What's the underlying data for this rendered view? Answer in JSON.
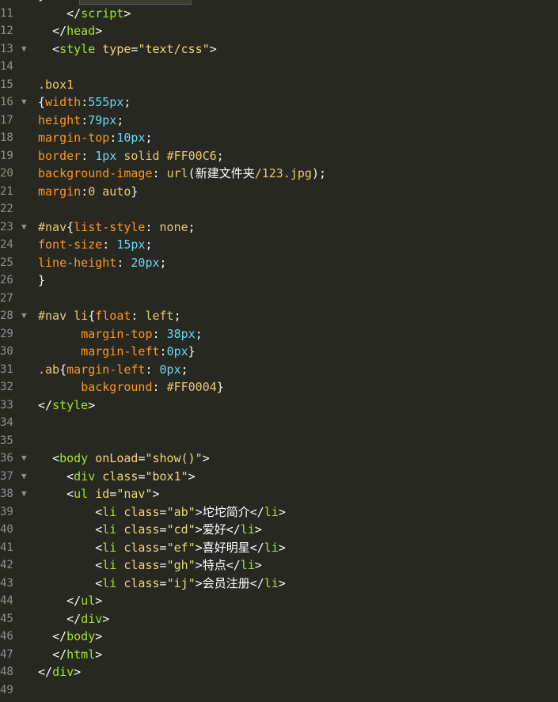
{
  "editor": {
    "theme_background": "#272822",
    "visible_tab_partial": "",
    "lines": [
      {
        "n": "10",
        "fold": false,
        "tokens": [
          {
            "t": "}",
            "c": "t-plain"
          }
        ]
      },
      {
        "n": "11",
        "fold": false,
        "tokens": [
          {
            "t": "    ",
            "c": "t-plain"
          },
          {
            "t": "</",
            "c": "t-punct"
          },
          {
            "t": "script",
            "c": "t-tag"
          },
          {
            "t": ">",
            "c": "t-punct"
          }
        ]
      },
      {
        "n": "12",
        "fold": false,
        "tokens": [
          {
            "t": "  ",
            "c": "t-plain"
          },
          {
            "t": "</",
            "c": "t-punct"
          },
          {
            "t": "head",
            "c": "t-tag"
          },
          {
            "t": ">",
            "c": "t-punct"
          }
        ]
      },
      {
        "n": "13",
        "fold": true,
        "tokens": [
          {
            "t": "  ",
            "c": "t-plain"
          },
          {
            "t": "<",
            "c": "t-punct"
          },
          {
            "t": "style",
            "c": "t-tag"
          },
          {
            "t": " type",
            "c": "t-attr"
          },
          {
            "t": "=",
            "c": "t-punct"
          },
          {
            "t": "\"text/css\"",
            "c": "t-str"
          },
          {
            "t": ">",
            "c": "t-punct"
          }
        ]
      },
      {
        "n": "14",
        "fold": false,
        "tokens": []
      },
      {
        "n": "15",
        "fold": false,
        "tokens": [
          {
            "t": ".box1",
            "c": "t-sel"
          }
        ]
      },
      {
        "n": "16",
        "fold": true,
        "tokens": [
          {
            "t": "{",
            "c": "t-plain"
          },
          {
            "t": "width",
            "c": "t-prop"
          },
          {
            "t": ":",
            "c": "t-plain"
          },
          {
            "t": "555px",
            "c": "t-num"
          },
          {
            "t": ";",
            "c": "t-plain"
          }
        ]
      },
      {
        "n": "17",
        "fold": false,
        "tokens": [
          {
            "t": "height",
            "c": "t-prop"
          },
          {
            "t": ":",
            "c": "t-plain"
          },
          {
            "t": "79px",
            "c": "t-num"
          },
          {
            "t": ";",
            "c": "t-plain"
          }
        ]
      },
      {
        "n": "18",
        "fold": false,
        "tokens": [
          {
            "t": "margin-top",
            "c": "t-prop"
          },
          {
            "t": ":",
            "c": "t-plain"
          },
          {
            "t": "10px",
            "c": "t-num"
          },
          {
            "t": ";",
            "c": "t-plain"
          }
        ]
      },
      {
        "n": "19",
        "fold": false,
        "tokens": [
          {
            "t": "border",
            "c": "t-prop"
          },
          {
            "t": ": ",
            "c": "t-plain"
          },
          {
            "t": "1px",
            "c": "t-num"
          },
          {
            "t": " solid ",
            "c": "t-sel"
          },
          {
            "t": "#FF00C6",
            "c": "t-sel"
          },
          {
            "t": ";",
            "c": "t-plain"
          }
        ]
      },
      {
        "n": "20",
        "fold": false,
        "tokens": [
          {
            "t": "background-image",
            "c": "t-prop"
          },
          {
            "t": ": ",
            "c": "t-plain"
          },
          {
            "t": "url",
            "c": "t-sel"
          },
          {
            "t": "(",
            "c": "t-plain"
          },
          {
            "t": "新建文件夹",
            "c": "t-cjk"
          },
          {
            "t": "/123.jpg",
            "c": "t-sel"
          },
          {
            "t": ");",
            "c": "t-plain"
          }
        ]
      },
      {
        "n": "21",
        "fold": false,
        "tokens": [
          {
            "t": "margin",
            "c": "t-prop"
          },
          {
            "t": ":",
            "c": "t-plain"
          },
          {
            "t": "0 auto",
            "c": "t-sel"
          },
          {
            "t": "}",
            "c": "t-plain"
          }
        ]
      },
      {
        "n": "22",
        "fold": false,
        "tokens": []
      },
      {
        "n": "23",
        "fold": true,
        "tokens": [
          {
            "t": "#nav",
            "c": "t-sel"
          },
          {
            "t": "{",
            "c": "t-plain"
          },
          {
            "t": "list-style",
            "c": "t-prop"
          },
          {
            "t": ": ",
            "c": "t-plain"
          },
          {
            "t": "none",
            "c": "t-sel"
          },
          {
            "t": ";",
            "c": "t-plain"
          }
        ]
      },
      {
        "n": "24",
        "fold": false,
        "tokens": [
          {
            "t": "font-size",
            "c": "t-prop"
          },
          {
            "t": ": ",
            "c": "t-plain"
          },
          {
            "t": "15px",
            "c": "t-num"
          },
          {
            "t": ";",
            "c": "t-plain"
          }
        ]
      },
      {
        "n": "25",
        "fold": false,
        "tokens": [
          {
            "t": "line-height",
            "c": "t-prop"
          },
          {
            "t": ": ",
            "c": "t-plain"
          },
          {
            "t": "20px",
            "c": "t-num"
          },
          {
            "t": ";",
            "c": "t-plain"
          }
        ]
      },
      {
        "n": "26",
        "fold": false,
        "tokens": [
          {
            "t": "}",
            "c": "t-plain"
          }
        ]
      },
      {
        "n": "27",
        "fold": false,
        "tokens": []
      },
      {
        "n": "28",
        "fold": true,
        "tokens": [
          {
            "t": "#nav li",
            "c": "t-sel"
          },
          {
            "t": "{",
            "c": "t-plain"
          },
          {
            "t": "float",
            "c": "t-prop"
          },
          {
            "t": ": ",
            "c": "t-plain"
          },
          {
            "t": "left",
            "c": "t-sel"
          },
          {
            "t": ";",
            "c": "t-plain"
          }
        ]
      },
      {
        "n": "29",
        "fold": false,
        "tokens": [
          {
            "t": "      ",
            "c": "t-plain"
          },
          {
            "t": "margin-top",
            "c": "t-prop"
          },
          {
            "t": ": ",
            "c": "t-plain"
          },
          {
            "t": "38px",
            "c": "t-num"
          },
          {
            "t": ";",
            "c": "t-plain"
          }
        ]
      },
      {
        "n": "30",
        "fold": false,
        "tokens": [
          {
            "t": "      ",
            "c": "t-plain"
          },
          {
            "t": "margin-left",
            "c": "t-prop"
          },
          {
            "t": ":",
            "c": "t-plain"
          },
          {
            "t": "0px",
            "c": "t-num"
          },
          {
            "t": "}",
            "c": "t-plain"
          }
        ]
      },
      {
        "n": "31",
        "fold": false,
        "tokens": [
          {
            "t": ".ab",
            "c": "t-sel"
          },
          {
            "t": "{",
            "c": "t-plain"
          },
          {
            "t": "margin-left",
            "c": "t-prop"
          },
          {
            "t": ": ",
            "c": "t-plain"
          },
          {
            "t": "0px",
            "c": "t-num"
          },
          {
            "t": ";",
            "c": "t-plain"
          }
        ]
      },
      {
        "n": "32",
        "fold": false,
        "tokens": [
          {
            "t": "      ",
            "c": "t-plain"
          },
          {
            "t": "background",
            "c": "t-prop"
          },
          {
            "t": ": ",
            "c": "t-plain"
          },
          {
            "t": "#FF0004",
            "c": "t-sel"
          },
          {
            "t": "}",
            "c": "t-plain"
          }
        ]
      },
      {
        "n": "33",
        "fold": false,
        "tokens": [
          {
            "t": "</",
            "c": "t-punct"
          },
          {
            "t": "style",
            "c": "t-tag"
          },
          {
            "t": ">",
            "c": "t-punct"
          }
        ]
      },
      {
        "n": "34",
        "fold": false,
        "tokens": []
      },
      {
        "n": "35",
        "fold": false,
        "tokens": []
      },
      {
        "n": "36",
        "fold": true,
        "tokens": [
          {
            "t": "  ",
            "c": "t-plain"
          },
          {
            "t": "<",
            "c": "t-punct"
          },
          {
            "t": "body",
            "c": "t-tag"
          },
          {
            "t": " onLoad",
            "c": "t-attr"
          },
          {
            "t": "=",
            "c": "t-punct"
          },
          {
            "t": "\"show()\"",
            "c": "t-str"
          },
          {
            "t": ">",
            "c": "t-punct"
          }
        ]
      },
      {
        "n": "37",
        "fold": true,
        "tokens": [
          {
            "t": "    ",
            "c": "t-plain"
          },
          {
            "t": "<",
            "c": "t-punct"
          },
          {
            "t": "div",
            "c": "t-tag"
          },
          {
            "t": " class",
            "c": "t-attr"
          },
          {
            "t": "=",
            "c": "t-punct"
          },
          {
            "t": "\"box1\"",
            "c": "t-str"
          },
          {
            "t": ">",
            "c": "t-punct"
          }
        ]
      },
      {
        "n": "38",
        "fold": true,
        "tokens": [
          {
            "t": "    ",
            "c": "t-plain"
          },
          {
            "t": "<",
            "c": "t-punct"
          },
          {
            "t": "ul",
            "c": "t-tag"
          },
          {
            "t": " id",
            "c": "t-attr"
          },
          {
            "t": "=",
            "c": "t-punct"
          },
          {
            "t": "\"nav\"",
            "c": "t-str"
          },
          {
            "t": ">",
            "c": "t-punct"
          }
        ]
      },
      {
        "n": "39",
        "fold": false,
        "tokens": [
          {
            "t": "        ",
            "c": "t-plain"
          },
          {
            "t": "<",
            "c": "t-punct"
          },
          {
            "t": "li",
            "c": "t-tag"
          },
          {
            "t": " class",
            "c": "t-attr"
          },
          {
            "t": "=",
            "c": "t-punct"
          },
          {
            "t": "\"ab\"",
            "c": "t-str"
          },
          {
            "t": ">",
            "c": "t-punct"
          },
          {
            "t": "坨坨简介",
            "c": "t-cjk"
          },
          {
            "t": "</",
            "c": "t-punct"
          },
          {
            "t": "li",
            "c": "t-tag"
          },
          {
            "t": ">",
            "c": "t-punct"
          }
        ]
      },
      {
        "n": "40",
        "fold": false,
        "tokens": [
          {
            "t": "        ",
            "c": "t-plain"
          },
          {
            "t": "<",
            "c": "t-punct"
          },
          {
            "t": "li",
            "c": "t-tag"
          },
          {
            "t": " class",
            "c": "t-attr"
          },
          {
            "t": "=",
            "c": "t-punct"
          },
          {
            "t": "\"cd\"",
            "c": "t-str"
          },
          {
            "t": ">",
            "c": "t-punct"
          },
          {
            "t": "爱好",
            "c": "t-cjk"
          },
          {
            "t": "</",
            "c": "t-punct"
          },
          {
            "t": "li",
            "c": "t-tag"
          },
          {
            "t": ">",
            "c": "t-punct"
          }
        ]
      },
      {
        "n": "41",
        "fold": false,
        "tokens": [
          {
            "t": "        ",
            "c": "t-plain"
          },
          {
            "t": "<",
            "c": "t-punct"
          },
          {
            "t": "li",
            "c": "t-tag"
          },
          {
            "t": " class",
            "c": "t-attr"
          },
          {
            "t": "=",
            "c": "t-punct"
          },
          {
            "t": "\"ef\"",
            "c": "t-str"
          },
          {
            "t": ">",
            "c": "t-punct"
          },
          {
            "t": "喜好明星",
            "c": "t-cjk"
          },
          {
            "t": "</",
            "c": "t-punct"
          },
          {
            "t": "li",
            "c": "t-tag"
          },
          {
            "t": ">",
            "c": "t-punct"
          }
        ]
      },
      {
        "n": "42",
        "fold": false,
        "tokens": [
          {
            "t": "        ",
            "c": "t-plain"
          },
          {
            "t": "<",
            "c": "t-punct"
          },
          {
            "t": "li",
            "c": "t-tag"
          },
          {
            "t": " class",
            "c": "t-attr"
          },
          {
            "t": "=",
            "c": "t-punct"
          },
          {
            "t": "\"gh\"",
            "c": "t-str"
          },
          {
            "t": ">",
            "c": "t-punct"
          },
          {
            "t": "特点",
            "c": "t-cjk"
          },
          {
            "t": "</",
            "c": "t-punct"
          },
          {
            "t": "li",
            "c": "t-tag"
          },
          {
            "t": ">",
            "c": "t-punct"
          }
        ]
      },
      {
        "n": "43",
        "fold": false,
        "tokens": [
          {
            "t": "        ",
            "c": "t-plain"
          },
          {
            "t": "<",
            "c": "t-punct"
          },
          {
            "t": "li",
            "c": "t-tag"
          },
          {
            "t": " class",
            "c": "t-attr"
          },
          {
            "t": "=",
            "c": "t-punct"
          },
          {
            "t": "\"ij\"",
            "c": "t-str"
          },
          {
            "t": ">",
            "c": "t-punct"
          },
          {
            "t": "会员注册",
            "c": "t-cjk"
          },
          {
            "t": "</",
            "c": "t-punct"
          },
          {
            "t": "li",
            "c": "t-tag"
          },
          {
            "t": ">",
            "c": "t-punct"
          }
        ]
      },
      {
        "n": "44",
        "fold": false,
        "tokens": [
          {
            "t": "    ",
            "c": "t-plain"
          },
          {
            "t": "</",
            "c": "t-punct"
          },
          {
            "t": "ul",
            "c": "t-tag"
          },
          {
            "t": ">",
            "c": "t-punct"
          }
        ]
      },
      {
        "n": "45",
        "fold": false,
        "tokens": [
          {
            "t": "    ",
            "c": "t-plain"
          },
          {
            "t": "</",
            "c": "t-punct"
          },
          {
            "t": "div",
            "c": "t-tag"
          },
          {
            "t": ">",
            "c": "t-punct"
          }
        ]
      },
      {
        "n": "46",
        "fold": false,
        "tokens": [
          {
            "t": "  ",
            "c": "t-plain"
          },
          {
            "t": "</",
            "c": "t-punct"
          },
          {
            "t": "body",
            "c": "t-tag"
          },
          {
            "t": ">",
            "c": "t-punct"
          }
        ]
      },
      {
        "n": "47",
        "fold": false,
        "tokens": [
          {
            "t": "  ",
            "c": "t-plain"
          },
          {
            "t": "</",
            "c": "t-punct"
          },
          {
            "t": "html",
            "c": "t-tag"
          },
          {
            "t": ">",
            "c": "t-punct"
          }
        ]
      },
      {
        "n": "48",
        "fold": false,
        "tokens": [
          {
            "t": "</",
            "c": "t-punct"
          },
          {
            "t": "div",
            "c": "t-tag"
          },
          {
            "t": ">",
            "c": "t-punct"
          }
        ]
      },
      {
        "n": "49",
        "fold": false,
        "tokens": []
      }
    ]
  }
}
